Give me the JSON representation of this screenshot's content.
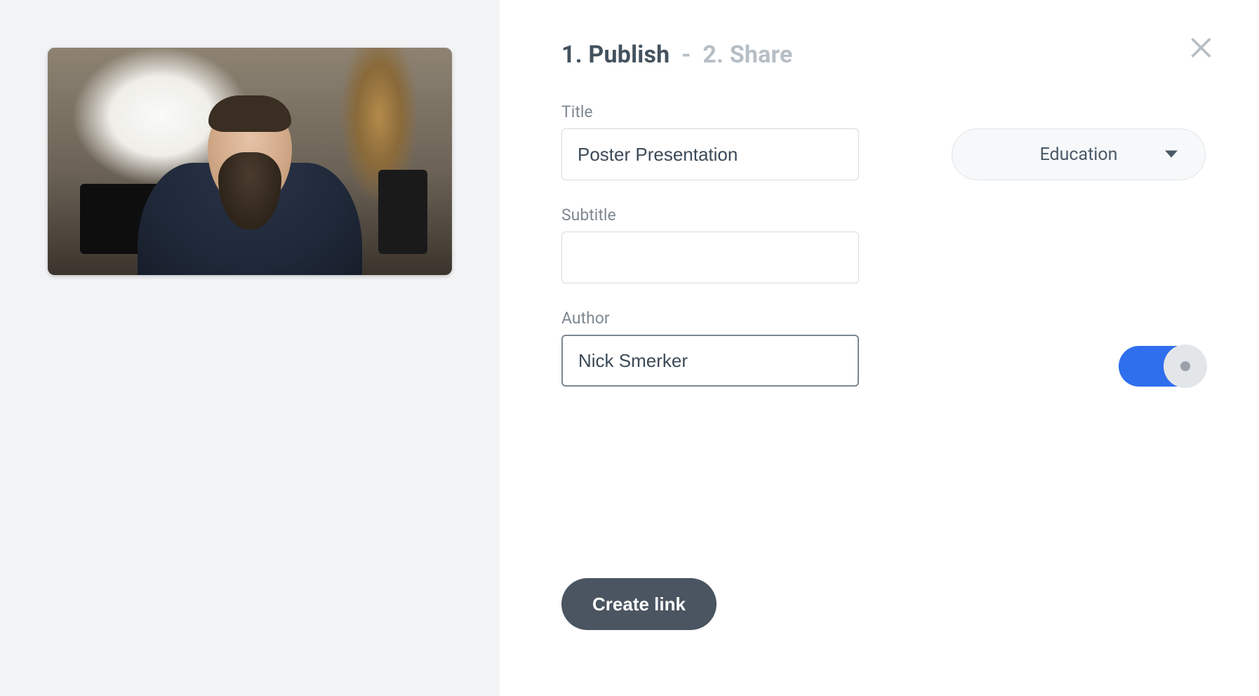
{
  "steps": {
    "active": "1. Publish",
    "inactive": "2. Share"
  },
  "labels": {
    "title": "Title",
    "subtitle": "Subtitle",
    "author": "Author"
  },
  "values": {
    "title": "Poster Presentation",
    "subtitle": "",
    "author": "Nick Smerker"
  },
  "category": {
    "selected": "Education"
  },
  "toggle": {
    "on": true
  },
  "buttons": {
    "create": "Create link"
  }
}
